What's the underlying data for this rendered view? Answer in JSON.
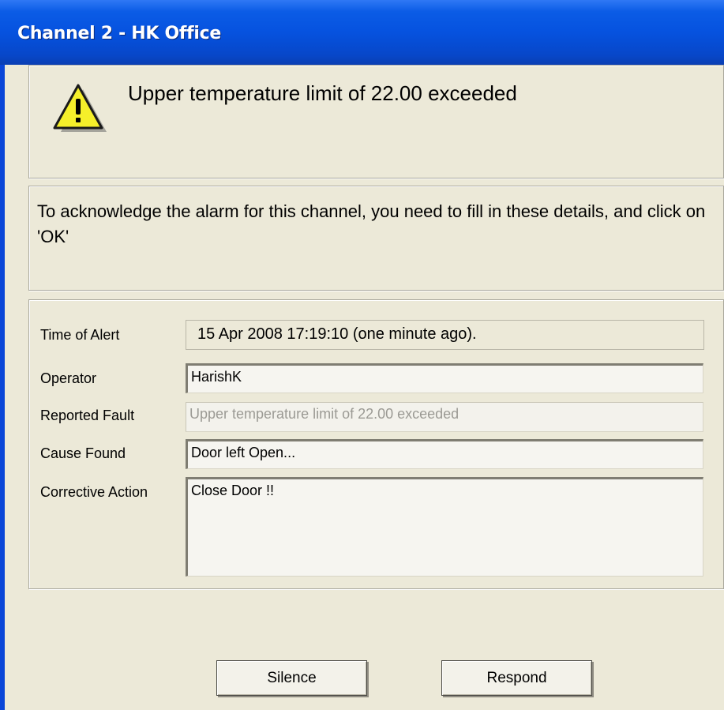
{
  "window": {
    "title": "Channel 2 - HK Office"
  },
  "alert": {
    "icon": "warning-icon",
    "message": "Upper temperature limit of 22.00 exceeded"
  },
  "instructions": {
    "text": "To acknowledge the alarm for this channel, you need to fill in these details, and click on 'OK'"
  },
  "form": {
    "time_label": "Time of Alert",
    "time_value": "15 Apr 2008 17:19:10 (one minute ago).",
    "operator_label": "Operator",
    "operator_value": "HarishK",
    "reported_label": "Reported Fault",
    "reported_value": "Upper temperature limit of 22.00 exceeded",
    "cause_label": "Cause Found",
    "cause_value": "Door left Open...",
    "action_label": "Corrective Action",
    "action_value": "Close Door !!"
  },
  "buttons": {
    "silence": "Silence",
    "respond": "Respond"
  },
  "colors": {
    "titlebar": "#0652df",
    "dialog": "#ece9d8",
    "warning": "#f5ef2a"
  }
}
